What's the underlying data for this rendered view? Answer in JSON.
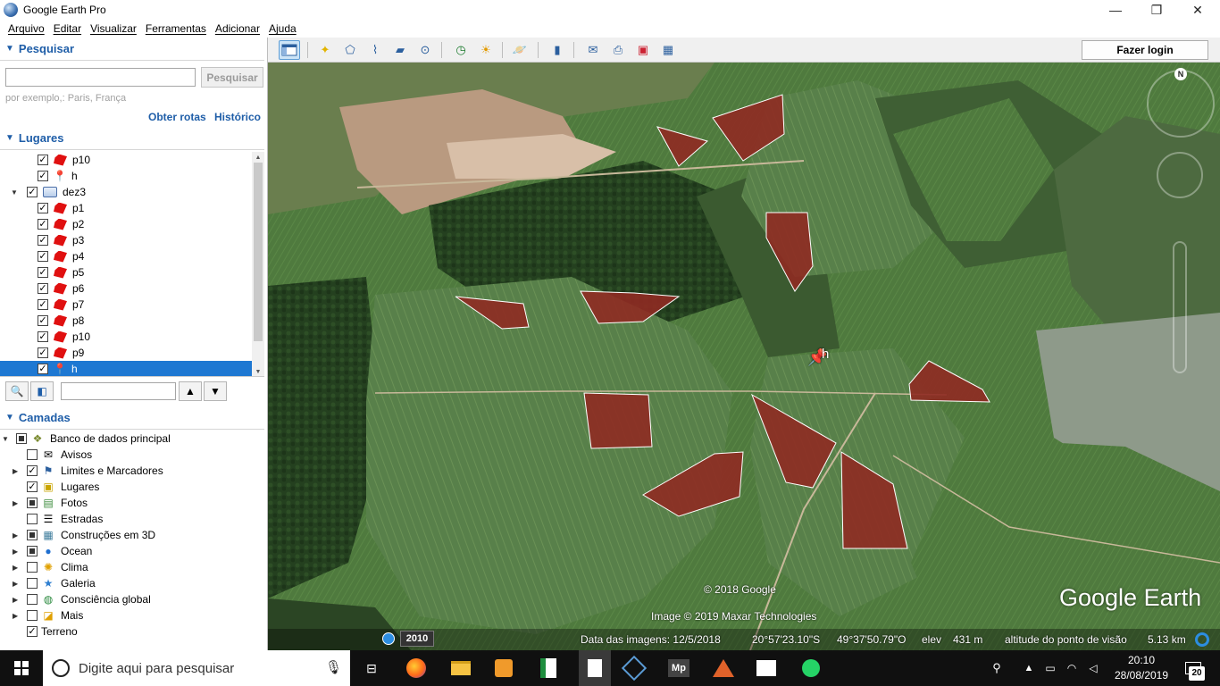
{
  "window": {
    "title": "Google Earth Pro",
    "minimize": "—",
    "maximize": "❐",
    "close": "✕"
  },
  "menu": [
    "Arquivo",
    "Editar",
    "Visualizar",
    "Ferramentas",
    "Adicionar",
    "Ajuda"
  ],
  "toolbar": {
    "login_label": "Fazer login",
    "icons": [
      "sidebar-icon",
      "placemark-icon",
      "polygon-icon",
      "path-icon",
      "overlay-icon",
      "tour-icon",
      "historical-imagery-icon",
      "sunlight-icon",
      "planets-icon",
      "ruler-icon",
      "email-icon",
      "print-icon",
      "save-image-icon",
      "maps-icon"
    ]
  },
  "search": {
    "header": "Pesquisar",
    "input_value": "",
    "button": "Pesquisar",
    "hint": "por exemplo,: Paris, França",
    "directions": "Obter rotas",
    "history": "Histórico"
  },
  "places": {
    "header": "Lugares",
    "items": [
      {
        "label": "p10",
        "type": "polygon",
        "checked": true
      },
      {
        "label": "h",
        "type": "pin",
        "checked": true
      },
      {
        "label": "dez3",
        "type": "folder",
        "checked": true
      },
      {
        "label": "p1",
        "type": "polygon",
        "checked": true
      },
      {
        "label": "p2",
        "type": "polygon",
        "checked": true
      },
      {
        "label": "p3",
        "type": "polygon",
        "checked": true
      },
      {
        "label": "p4",
        "type": "polygon",
        "checked": true
      },
      {
        "label": "p5",
        "type": "polygon",
        "checked": true
      },
      {
        "label": "p6",
        "type": "polygon",
        "checked": true
      },
      {
        "label": "p7",
        "type": "polygon",
        "checked": true
      },
      {
        "label": "p8",
        "type": "polygon",
        "checked": true
      },
      {
        "label": "p10",
        "type": "polygon",
        "checked": true
      },
      {
        "label": "p9",
        "type": "polygon",
        "checked": true
      },
      {
        "label": "h",
        "type": "pin",
        "checked": true,
        "selected": true
      }
    ]
  },
  "layers": {
    "header": "Camadas",
    "items": [
      {
        "label": "Banco de dados principal",
        "check": "partial",
        "expander": "▼",
        "icon": "database-icon"
      },
      {
        "label": "Avisos",
        "check": "off",
        "expander": "",
        "icon": "envelope-icon"
      },
      {
        "label": "Limites e Marcadores",
        "check": "on",
        "expander": "▶",
        "icon": "flag-icon"
      },
      {
        "label": "Lugares",
        "check": "on",
        "expander": "",
        "icon": "places-icon"
      },
      {
        "label": "Fotos",
        "check": "partial",
        "expander": "▶",
        "icon": "photo-icon"
      },
      {
        "label": "Estradas",
        "check": "off",
        "expander": "",
        "icon": "road-icon"
      },
      {
        "label": "Construções em 3D",
        "check": "partial",
        "expander": "▶",
        "icon": "building-icon"
      },
      {
        "label": "Ocean",
        "check": "partial",
        "expander": "▶",
        "icon": "ocean-icon"
      },
      {
        "label": "Clima",
        "check": "off",
        "expander": "▶",
        "icon": "weather-icon"
      },
      {
        "label": "Galeria",
        "check": "off",
        "expander": "▶",
        "icon": "gallery-icon"
      },
      {
        "label": "Consciência global",
        "check": "off",
        "expander": "▶",
        "icon": "globe-icon"
      },
      {
        "label": "Mais",
        "check": "off",
        "expander": "▶",
        "icon": "more-icon"
      },
      {
        "label": "Terreno",
        "check": "on",
        "expander": "",
        "icon": ""
      }
    ]
  },
  "map": {
    "pin_label": "h",
    "copyright": "© 2018 Google",
    "imagery_credit": "Image © 2019 Maxar Technologies",
    "logo": "Google Earth",
    "north": "N",
    "year": "2010",
    "status": {
      "imagery_date": "Data das imagens: 12/5/2018",
      "lat": "20°57'23.10\"S",
      "lon": "49°37'50.79\"O",
      "elev_label": "elev",
      "elev": "431 m",
      "eye_alt_label": "altitude do ponto de visão",
      "eye_alt": "5.13 km"
    },
    "colors": {
      "polygon_fill": "#8f2a22",
      "polygon_stroke": "#ffffff"
    }
  },
  "taskbar": {
    "search_placeholder": "Digite aqui para pesquisar",
    "time": "20:10",
    "date": "28/08/2019",
    "notifications": "20",
    "apps": [
      "task-view-icon",
      "firefox-icon",
      "file-explorer-icon",
      "sublime-icon",
      "spreadsheet-icon",
      "document-icon",
      "virtualbox-icon",
      "mp-icon",
      "matlab-icon",
      "photos-icon",
      "whatsapp-icon"
    ]
  }
}
